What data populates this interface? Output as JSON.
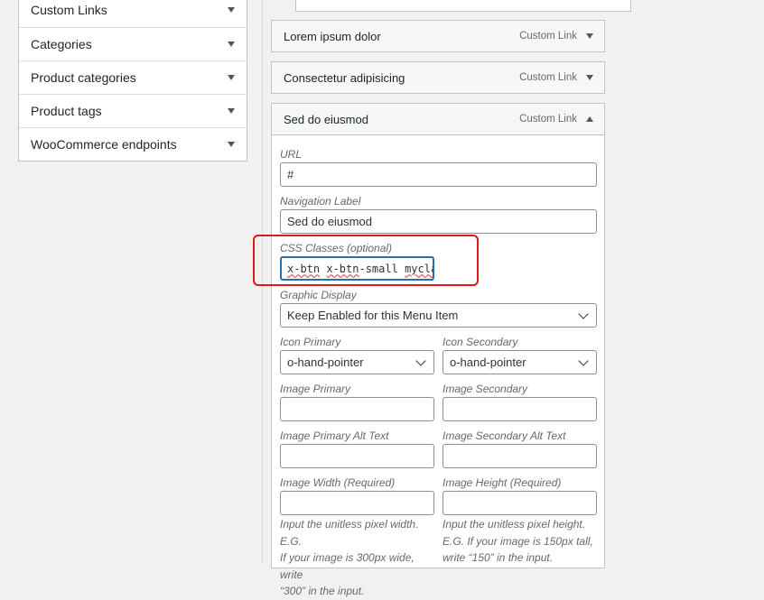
{
  "left_panel": {
    "items": [
      {
        "label": "Custom Links"
      },
      {
        "label": "Categories"
      },
      {
        "label": "Product categories"
      },
      {
        "label": "Product tags"
      },
      {
        "label": "WooCommerce endpoints"
      }
    ]
  },
  "menu_items": [
    {
      "title": "Lorem ipsum dolor",
      "type": "Custom Link"
    },
    {
      "title": "Consectetur adipisicing",
      "type": "Custom Link"
    },
    {
      "title": "Sed do eiusmod",
      "type": "Custom Link"
    }
  ],
  "settings": {
    "url_label": "URL",
    "url_value": "#",
    "nav_label_label": "Navigation Label",
    "nav_label_value": "Sed do eiusmod",
    "css_label": "CSS Classes (optional)",
    "css_value_1": "x-btn",
    "css_value_2": "x-btn",
    "css_value_3": "-small",
    "css_value_4": "mycla",
    "graphic_label": "Graphic Display",
    "graphic_value": "Keep Enabled for this Menu Item",
    "icon_primary_label": "Icon Primary",
    "icon_primary_value": "o-hand-pointer",
    "icon_secondary_label": "Icon Secondary",
    "icon_secondary_value": "o-hand-pointer",
    "image_primary_label": "Image Primary",
    "image_secondary_label": "Image Secondary",
    "image_primary_alt_label": "Image Primary Alt Text",
    "image_secondary_alt_label": "Image Secondary Alt Text",
    "image_width_label": "Image Width (Required)",
    "image_height_label": "Image Height (Required)",
    "width_help_1": "Input the unitless pixel width. E.G.",
    "width_help_2": "If your image is 300px wide, write",
    "width_help_3": "“300” in the input.",
    "height_help_1": "Input the unitless pixel height.",
    "height_help_2": "E.G. If your image is 150px tall,",
    "height_help_3": "write “150” in the input."
  }
}
